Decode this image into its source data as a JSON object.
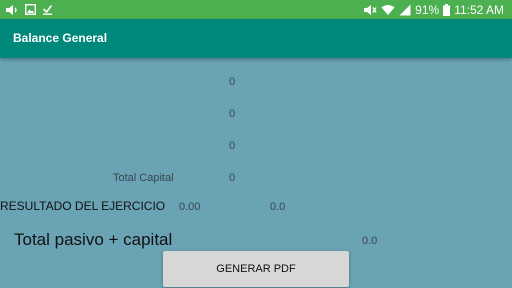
{
  "status_bar": {
    "battery_percent": "91%",
    "time": "11:52 AM"
  },
  "app_bar": {
    "title": "Balance General"
  },
  "main": {
    "value_row_1": "0",
    "value_row_2": "0",
    "value_row_3": "0",
    "total_capital_label": "Total Capital",
    "total_capital_value": "0",
    "resultado_label": "RESULTADO DEL EJERCICIO",
    "resultado_value_1": "0.00",
    "resultado_value_2": "0.0",
    "total_pasivo_capital_label": "Total pasivo + capital",
    "total_pasivo_capital_value": "0.0"
  },
  "actions": {
    "generate_pdf_label": "GENERAR PDF"
  }
}
